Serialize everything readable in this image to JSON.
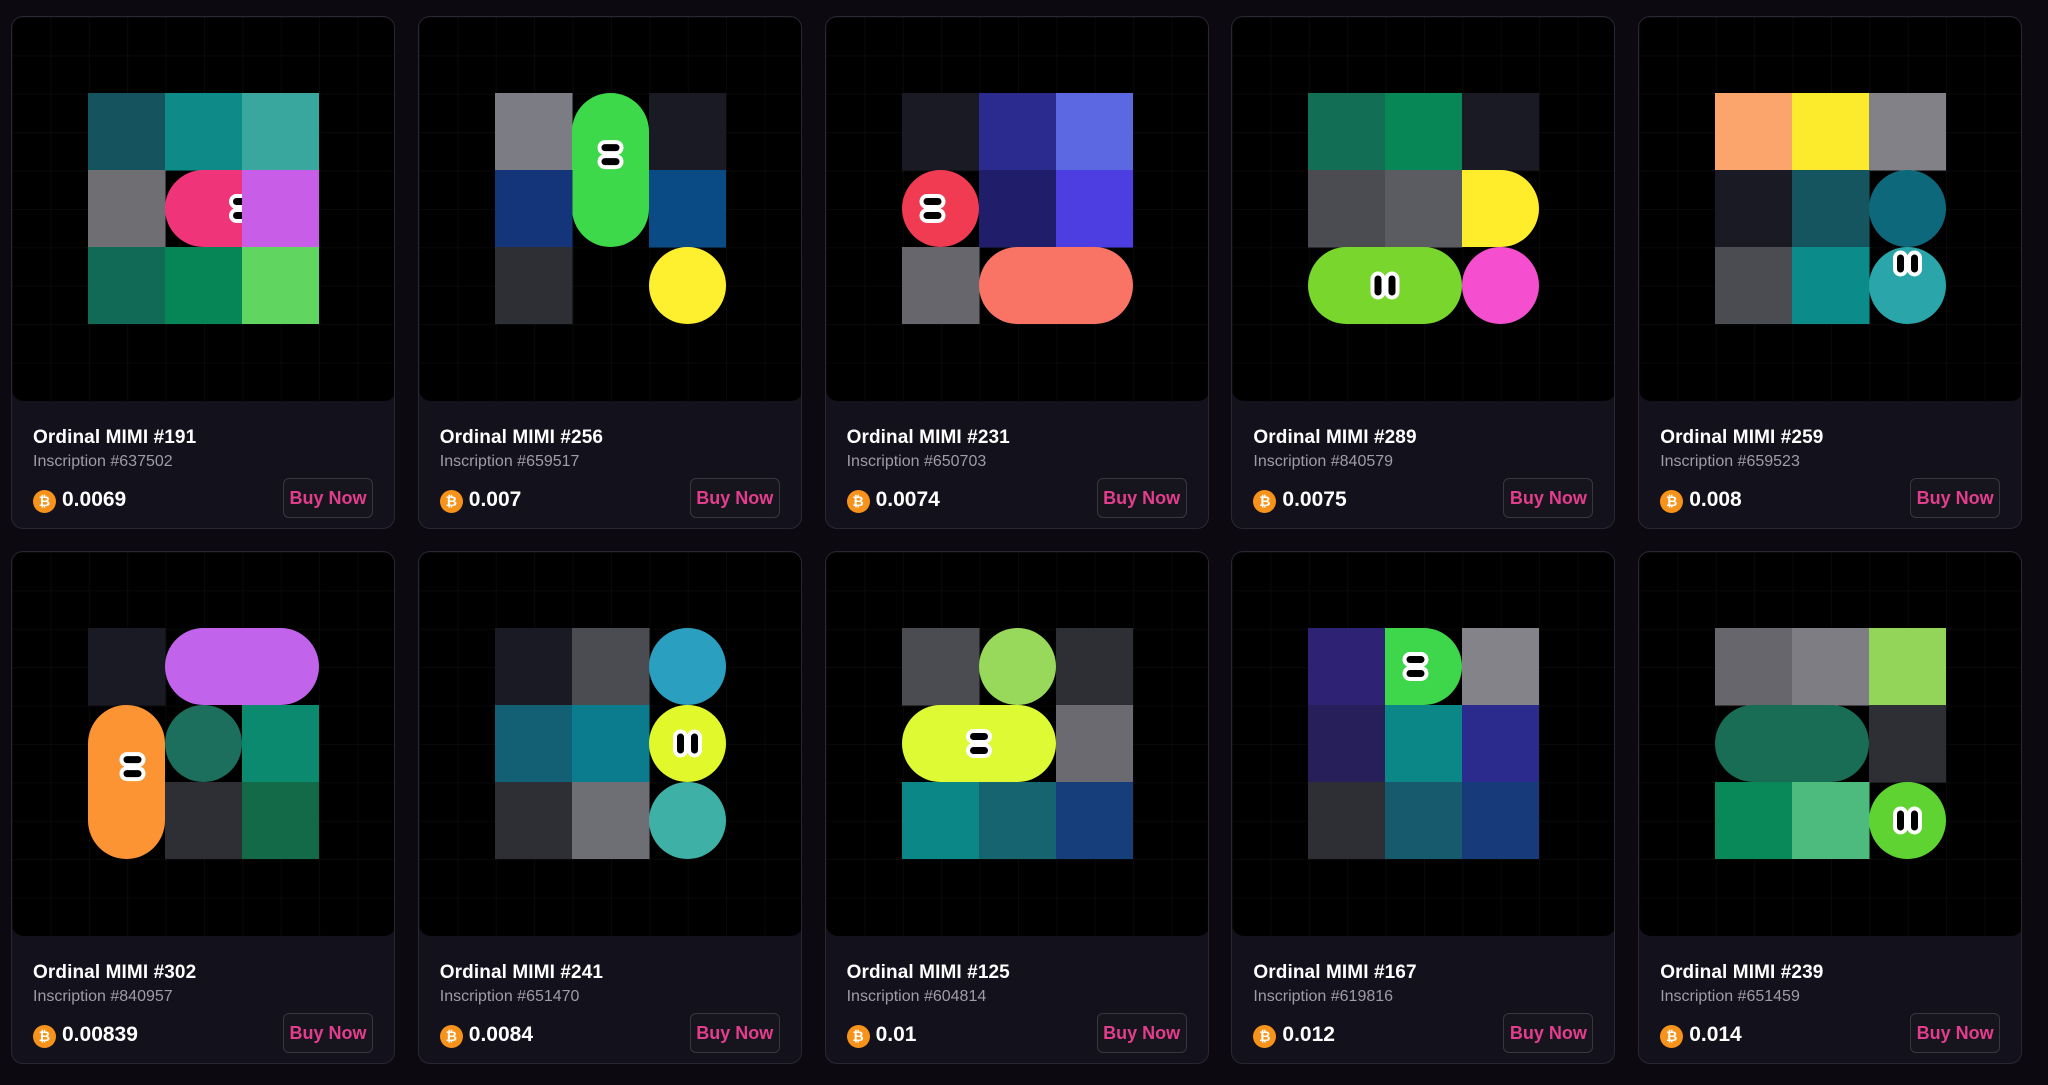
{
  "currency_icon": "bitcoin-icon",
  "accent_color": "#e33d8d",
  "cards": [
    {
      "name": "Ordinal MIMI #191",
      "inscription": "Inscription #637502",
      "price": "0.0069",
      "buy_label": "Buy Now",
      "art": [
        {
          "s": "r",
          "c": "#15535f",
          "x": 0,
          "y": 0
        },
        {
          "s": "r",
          "c": "#0e8b88",
          "x": 1,
          "y": 0
        },
        {
          "s": "r",
          "c": "#3aa79f",
          "x": 2,
          "y": 0
        },
        {
          "s": "r",
          "c": "#6f6f73",
          "x": 0,
          "y": 1
        },
        {
          "s": "ph",
          "c": "#f0347a",
          "x": 1,
          "y": 1,
          "eyes": "h"
        },
        {
          "s": "r",
          "c": "#c85ee7",
          "x": 2,
          "y": 1
        },
        {
          "s": "r",
          "c": "#106a55",
          "x": 0,
          "y": 2
        },
        {
          "s": "r",
          "c": "#068656",
          "x": 1,
          "y": 2
        },
        {
          "s": "r",
          "c": "#60d55f",
          "x": 2,
          "y": 2
        }
      ]
    },
    {
      "name": "Ordinal MIMI #256",
      "inscription": "Inscription #659517",
      "price": "0.007",
      "buy_label": "Buy Now",
      "art": [
        {
          "s": "r",
          "c": "#7c7c84",
          "x": 0,
          "y": 0
        },
        {
          "s": "pv",
          "c": "#3dd94a",
          "x": 1,
          "y": 0,
          "eyes": "h"
        },
        {
          "s": "r",
          "c": "#1a1a25",
          "x": 2,
          "y": 0
        },
        {
          "s": "r",
          "c": "#15357a",
          "x": 0,
          "y": 1
        },
        {
          "s": "r",
          "c": "#0a4b85",
          "x": 2,
          "y": 1
        },
        {
          "s": "r",
          "c": "#2e2f34",
          "x": 0,
          "y": 2
        },
        {
          "s": "c",
          "c": "#fff02f",
          "x": 2,
          "y": 2
        }
      ]
    },
    {
      "name": "Ordinal MIMI #231",
      "inscription": "Inscription #650703",
      "price": "0.0074",
      "buy_label": "Buy Now",
      "art": [
        {
          "s": "r",
          "c": "#1a1a25",
          "x": 0,
          "y": 0
        },
        {
          "s": "r",
          "c": "#2b2a8f",
          "x": 1,
          "y": 0
        },
        {
          "s": "r",
          "c": "#5c68e1",
          "x": 2,
          "y": 0
        },
        {
          "s": "c",
          "c": "#f03b52",
          "x": 0,
          "y": 1,
          "eyes": "hl"
        },
        {
          "s": "r",
          "c": "#201e6b",
          "x": 1,
          "y": 1
        },
        {
          "s": "r",
          "c": "#4c3ee0",
          "x": 2,
          "y": 1
        },
        {
          "s": "r",
          "c": "#67666d",
          "x": 0,
          "y": 2
        },
        {
          "s": "ph",
          "c": "#f97465",
          "x": 1,
          "y": 2
        }
      ]
    },
    {
      "name": "Ordinal MIMI #289",
      "inscription": "Inscription #840579",
      "price": "0.0075",
      "buy_label": "Buy Now",
      "art": [
        {
          "s": "r",
          "c": "#126f55",
          "x": 0,
          "y": 0
        },
        {
          "s": "r",
          "c": "#088756",
          "x": 1,
          "y": 0
        },
        {
          "s": "r",
          "c": "#1a1a25",
          "x": 2,
          "y": 0
        },
        {
          "s": "r",
          "c": "#4b4b52",
          "x": 0,
          "y": 1
        },
        {
          "s": "r",
          "c": "#5b5b62",
          "x": 1,
          "y": 1
        },
        {
          "s": "hr",
          "c": "#ffed2c",
          "x": 2,
          "y": 1
        },
        {
          "s": "ph",
          "c": "#78d62d",
          "x": 0,
          "y": 2,
          "eyes": "v"
        },
        {
          "s": "c",
          "c": "#f54fd0",
          "x": 2,
          "y": 2
        }
      ]
    },
    {
      "name": "Ordinal MIMI #259",
      "inscription": "Inscription #659523",
      "price": "0.008",
      "buy_label": "Buy Now",
      "art": [
        {
          "s": "r",
          "c": "#fba56c",
          "x": 0,
          "y": 0
        },
        {
          "s": "r",
          "c": "#fbeb2c",
          "x": 1,
          "y": 0
        },
        {
          "s": "r",
          "c": "#818187",
          "x": 2,
          "y": 0
        },
        {
          "s": "r",
          "c": "#1a1a25",
          "x": 0,
          "y": 1
        },
        {
          "s": "r",
          "c": "#15555f",
          "x": 1,
          "y": 1
        },
        {
          "s": "c",
          "c": "#0d687c",
          "x": 2,
          "y": 1
        },
        {
          "s": "r",
          "c": "#4b4b52",
          "x": 0,
          "y": 2
        },
        {
          "s": "r",
          "c": "#0b8c8a",
          "x": 1,
          "y": 2
        },
        {
          "s": "c",
          "c": "#2aa5a9",
          "x": 2,
          "y": 2,
          "eyes": "vt"
        }
      ]
    },
    {
      "name": "Ordinal MIMI #302",
      "inscription": "Inscription #840957",
      "price": "0.00839",
      "buy_label": "Buy Now",
      "art": [
        {
          "s": "r",
          "c": "#1a1a25",
          "x": 0,
          "y": 0
        },
        {
          "s": "ph",
          "c": "#c263ec",
          "x": 1,
          "y": 0
        },
        {
          "s": "pv",
          "c": "#fc9433",
          "x": 0,
          "y": 1,
          "eyes": "hr"
        },
        {
          "s": "c",
          "c": "#1c6e5d",
          "x": 1,
          "y": 1
        },
        {
          "s": "r",
          "c": "#0c8a6f",
          "x": 2,
          "y": 1
        },
        {
          "s": "r",
          "c": "#2e2f34",
          "x": 1,
          "y": 2
        },
        {
          "s": "r",
          "c": "#126a49",
          "x": 2,
          "y": 2
        }
      ]
    },
    {
      "name": "Ordinal MIMI #241",
      "inscription": "Inscription #651470",
      "price": "0.0084",
      "buy_label": "Buy Now",
      "art": [
        {
          "s": "r",
          "c": "#1a1a25",
          "x": 0,
          "y": 0
        },
        {
          "s": "r",
          "c": "#4b4b52",
          "x": 1,
          "y": 0
        },
        {
          "s": "c",
          "c": "#2a9fc0",
          "x": 2,
          "y": 0
        },
        {
          "s": "r",
          "c": "#135f73",
          "x": 0,
          "y": 1
        },
        {
          "s": "r",
          "c": "#0a7c8e",
          "x": 1,
          "y": 1
        },
        {
          "s": "c",
          "c": "#e1f82a",
          "x": 2,
          "y": 1,
          "eyes": "v"
        },
        {
          "s": "r",
          "c": "#2e2f34",
          "x": 0,
          "y": 2
        },
        {
          "s": "r",
          "c": "#6e6e75",
          "x": 1,
          "y": 2
        },
        {
          "s": "c",
          "c": "#3fb0a6",
          "x": 2,
          "y": 2
        }
      ]
    },
    {
      "name": "Ordinal MIMI #125",
      "inscription": "Inscription #604814",
      "price": "0.01",
      "buy_label": "Buy Now",
      "art": [
        {
          "s": "r",
          "c": "#4b4b52",
          "x": 0,
          "y": 0
        },
        {
          "s": "c",
          "c": "#98d95c",
          "x": 1,
          "y": 0
        },
        {
          "s": "r",
          "c": "#2e2f34",
          "x": 2,
          "y": 0
        },
        {
          "s": "ph",
          "c": "#ddfa35",
          "x": 0,
          "y": 1,
          "eyes": "h"
        },
        {
          "s": "r",
          "c": "#6a6a70",
          "x": 2,
          "y": 1
        },
        {
          "s": "r",
          "c": "#0b8787",
          "x": 0,
          "y": 2
        },
        {
          "s": "r",
          "c": "#15646f",
          "x": 1,
          "y": 2
        },
        {
          "s": "r",
          "c": "#153e7a",
          "x": 2,
          "y": 2
        }
      ]
    },
    {
      "name": "Ordinal MIMI #167",
      "inscription": "Inscription #619816",
      "price": "0.012",
      "buy_label": "Buy Now",
      "art": [
        {
          "s": "r",
          "c": "#2d2273",
          "x": 0,
          "y": 0
        },
        {
          "s": "hr",
          "c": "#3ed74b",
          "x": 1,
          "y": 0,
          "eyes": "hl"
        },
        {
          "s": "r",
          "c": "#838389",
          "x": 2,
          "y": 0
        },
        {
          "s": "r",
          "c": "#261f59",
          "x": 0,
          "y": 1
        },
        {
          "s": "r",
          "c": "#0c8788",
          "x": 1,
          "y": 1
        },
        {
          "s": "r",
          "c": "#2a2b8c",
          "x": 2,
          "y": 1
        },
        {
          "s": "r",
          "c": "#2e2f34",
          "x": 0,
          "y": 2
        },
        {
          "s": "r",
          "c": "#175a6d",
          "x": 1,
          "y": 2
        },
        {
          "s": "r",
          "c": "#173a7b",
          "x": 2,
          "y": 2
        }
      ]
    },
    {
      "name": "Ordinal MIMI #239",
      "inscription": "Inscription #651459",
      "price": "0.014",
      "buy_label": "Buy Now",
      "art": [
        {
          "s": "r",
          "c": "#66666c",
          "x": 0,
          "y": 0
        },
        {
          "s": "r",
          "c": "#7d7d83",
          "x": 1,
          "y": 0
        },
        {
          "s": "r",
          "c": "#93d558",
          "x": 2,
          "y": 0
        },
        {
          "s": "ph",
          "c": "#186d54",
          "x": 0,
          "y": 1
        },
        {
          "s": "r",
          "c": "#2e2f34",
          "x": 2,
          "y": 1
        },
        {
          "s": "r",
          "c": "#09885a",
          "x": 0,
          "y": 2
        },
        {
          "s": "r",
          "c": "#4dbb7d",
          "x": 1,
          "y": 2
        },
        {
          "s": "c",
          "c": "#5fd332",
          "x": 2,
          "y": 2,
          "eyes": "v"
        }
      ]
    }
  ]
}
